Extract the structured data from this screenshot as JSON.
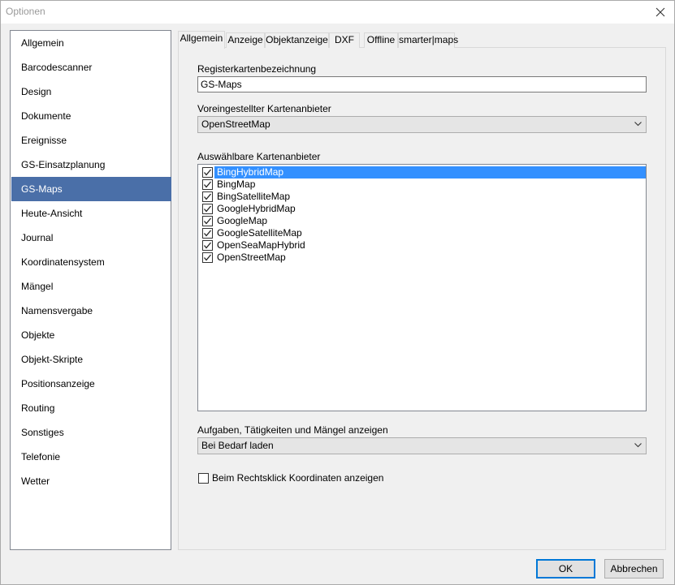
{
  "window": {
    "title": "Optionen"
  },
  "sidebar": {
    "items": [
      {
        "label": "Allgemein"
      },
      {
        "label": "Barcodescanner"
      },
      {
        "label": "Design"
      },
      {
        "label": "Dokumente"
      },
      {
        "label": "Ereignisse"
      },
      {
        "label": "GS-Einsatzplanung"
      },
      {
        "label": "GS-Maps",
        "selected": true
      },
      {
        "label": "Heute-Ansicht"
      },
      {
        "label": "Journal"
      },
      {
        "label": "Koordinatensystem"
      },
      {
        "label": "Mängel"
      },
      {
        "label": "Namensvergabe"
      },
      {
        "label": "Objekte"
      },
      {
        "label": "Objekt-Skripte"
      },
      {
        "label": "Positionsanzeige"
      },
      {
        "label": "Routing"
      },
      {
        "label": "Sonstiges"
      },
      {
        "label": "Telefonie"
      },
      {
        "label": "Wetter"
      }
    ]
  },
  "tabs": [
    {
      "label": "Allgemein",
      "active": true
    },
    {
      "label": "Anzeige"
    },
    {
      "label": "Objektanzeige"
    },
    {
      "label": "DXF"
    },
    {
      "label": "Offline"
    },
    {
      "label": "smarter|maps"
    }
  ],
  "form": {
    "tab_name_label": "Registerkartenbezeichnung",
    "tab_name_value": "GS-Maps",
    "default_provider_label": "Voreingestellter Kartenanbieter",
    "default_provider_value": "OpenStreetMap",
    "providers_label": "Auswählbare Kartenanbieter",
    "providers": [
      {
        "label": "BingHybridMap",
        "checked": true,
        "selected": true
      },
      {
        "label": "BingMap",
        "checked": true
      },
      {
        "label": "BingSatelliteMap",
        "checked": true
      },
      {
        "label": "GoogleHybridMap",
        "checked": true
      },
      {
        "label": "GoogleMap",
        "checked": true
      },
      {
        "label": "GoogleSatelliteMap",
        "checked": true
      },
      {
        "label": "OpenSeaMapHybrid",
        "checked": true
      },
      {
        "label": "OpenStreetMap",
        "checked": true
      }
    ],
    "tasks_label": "Aufgaben, Tätigkeiten und Mängel anzeigen",
    "tasks_value": "Bei Bedarf laden",
    "right_click_label": "Beim Rechtsklick Koordinaten anzeigen",
    "right_click_checked": false
  },
  "buttons": {
    "ok": "OK",
    "cancel": "Abbrechen"
  },
  "colors": {
    "selection_sidebar": "#4a6fa8",
    "selection_list": "#3390ff",
    "default_button_border": "#0078d7"
  }
}
